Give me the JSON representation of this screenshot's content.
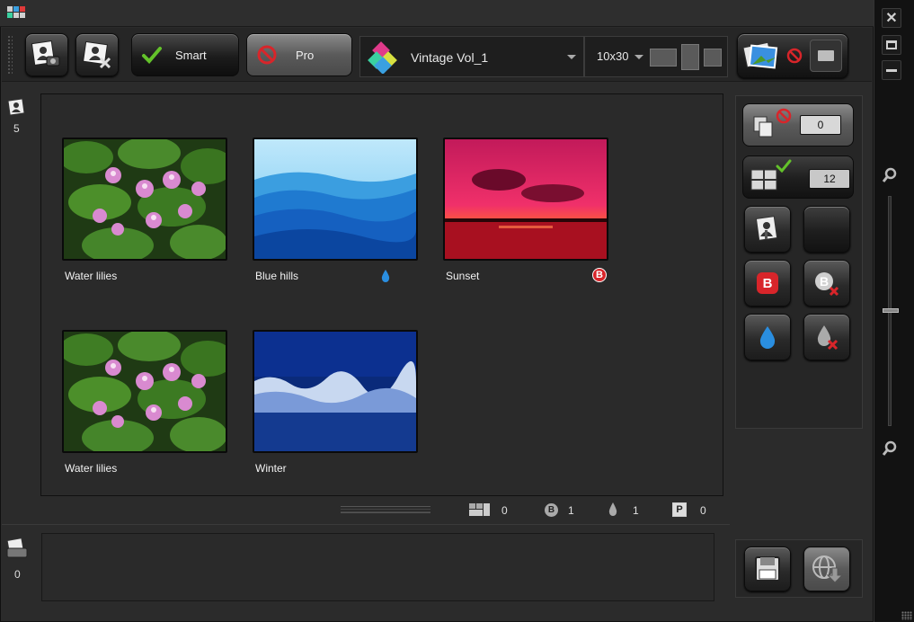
{
  "toolbar": {
    "smart_label": "Smart",
    "pro_label": "Pro",
    "preset_name": "Vintage Vol_1",
    "size_value": "10x30"
  },
  "sidebar_left": {
    "photos_count": "5",
    "tray_count": "0"
  },
  "gallery": {
    "items": [
      {
        "caption": "Water lilies",
        "badge": ""
      },
      {
        "caption": "Blue hills",
        "badge": "drop"
      },
      {
        "caption": "Sunset",
        "badge": "B"
      },
      {
        "caption": "Water lilies",
        "badge": ""
      },
      {
        "caption": "Winter",
        "badge": ""
      }
    ]
  },
  "right_panel": {
    "excluded_count": "0",
    "included_count": "12",
    "b_badge_label": "B"
  },
  "statusbar": {
    "layout_count": "0",
    "b_label": "B",
    "b_count": "1",
    "drop_count": "1",
    "p_label": "P",
    "p_count": "0"
  },
  "colors": {
    "accent_green": "#63c22a",
    "deny_red": "#d8252a",
    "drop_blue": "#2a8ee0"
  }
}
